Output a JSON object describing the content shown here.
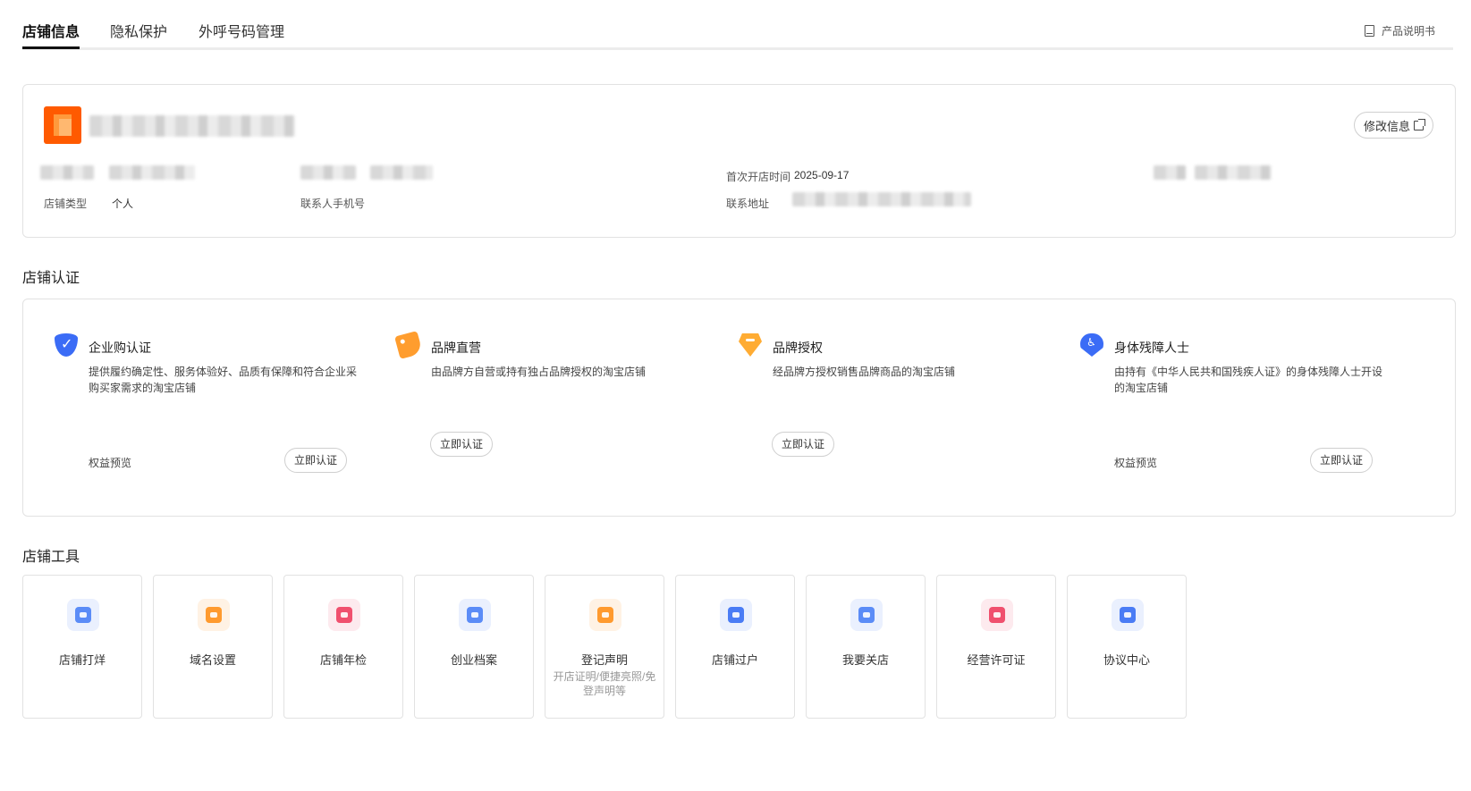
{
  "tabs": [
    {
      "label": "店铺信息",
      "active": true
    },
    {
      "label": "隐私保护",
      "active": false
    },
    {
      "label": "外呼号码管理",
      "active": false
    }
  ],
  "manual_label": "产品说明书",
  "store_info": {
    "edit_label": "修改信息",
    "shop_type_label": "店铺类型",
    "shop_type_value": "个人",
    "contact_phone_label": "联系人手机号",
    "first_open_label": "首次开店时间",
    "first_open_value": "2025-09-17",
    "address_label": "联系地址"
  },
  "cert_section": {
    "title": "店铺认证",
    "items": [
      {
        "title": "企业购认证",
        "desc": "提供履约确定性、服务体验好、品质有保障和符合企业采购买家需求的淘宝店铺",
        "perk": "权益预览",
        "button": "立即认证",
        "icon": "blue-shield-check-icon"
      },
      {
        "title": "品牌直营",
        "desc": "由品牌方自营或持有独占品牌授权的淘宝店铺",
        "perk": "",
        "button": "立即认证",
        "icon": "orange-tag-icon"
      },
      {
        "title": "品牌授权",
        "desc": "经品牌方授权销售品牌商品的淘宝店铺",
        "perk": "",
        "button": "立即认证",
        "icon": "orange-diamond-icon"
      },
      {
        "title": "身体残障人士",
        "desc": "由持有《中华人民共和国残疾人证》的身体残障人士开设的淘宝店铺",
        "perk": "权益预览",
        "button": "立即认证",
        "icon": "blue-heart-accessibility-icon"
      }
    ]
  },
  "tools_section": {
    "title": "店铺工具",
    "items": [
      {
        "label": "店铺打烊",
        "sub": "",
        "icon": "shop-closed-icon",
        "color": "#5b8cf7"
      },
      {
        "label": "域名设置",
        "sub": "",
        "icon": "domain-settings-icon",
        "color": "#ff9a2e"
      },
      {
        "label": "店铺年检",
        "sub": "",
        "icon": "annual-inspection-icon",
        "color": "#f0506e"
      },
      {
        "label": "创业档案",
        "sub": "",
        "icon": "business-archive-icon",
        "color": "#5b8cf7"
      },
      {
        "label": "登记声明",
        "sub": "开店证明/便捷亮照/免登声明等",
        "icon": "registration-statement-icon",
        "color": "#ff9a2e"
      },
      {
        "label": "店铺过户",
        "sub": "",
        "icon": "shop-transfer-icon",
        "color": "#4a7cf5"
      },
      {
        "label": "我要关店",
        "sub": "",
        "icon": "close-shop-icon",
        "color": "#5b8cf7"
      },
      {
        "label": "经营许可证",
        "sub": "",
        "icon": "business-license-icon",
        "color": "#f0506e"
      },
      {
        "label": "协议中心",
        "sub": "",
        "icon": "agreement-center-icon",
        "color": "#4a7cf5"
      }
    ]
  }
}
